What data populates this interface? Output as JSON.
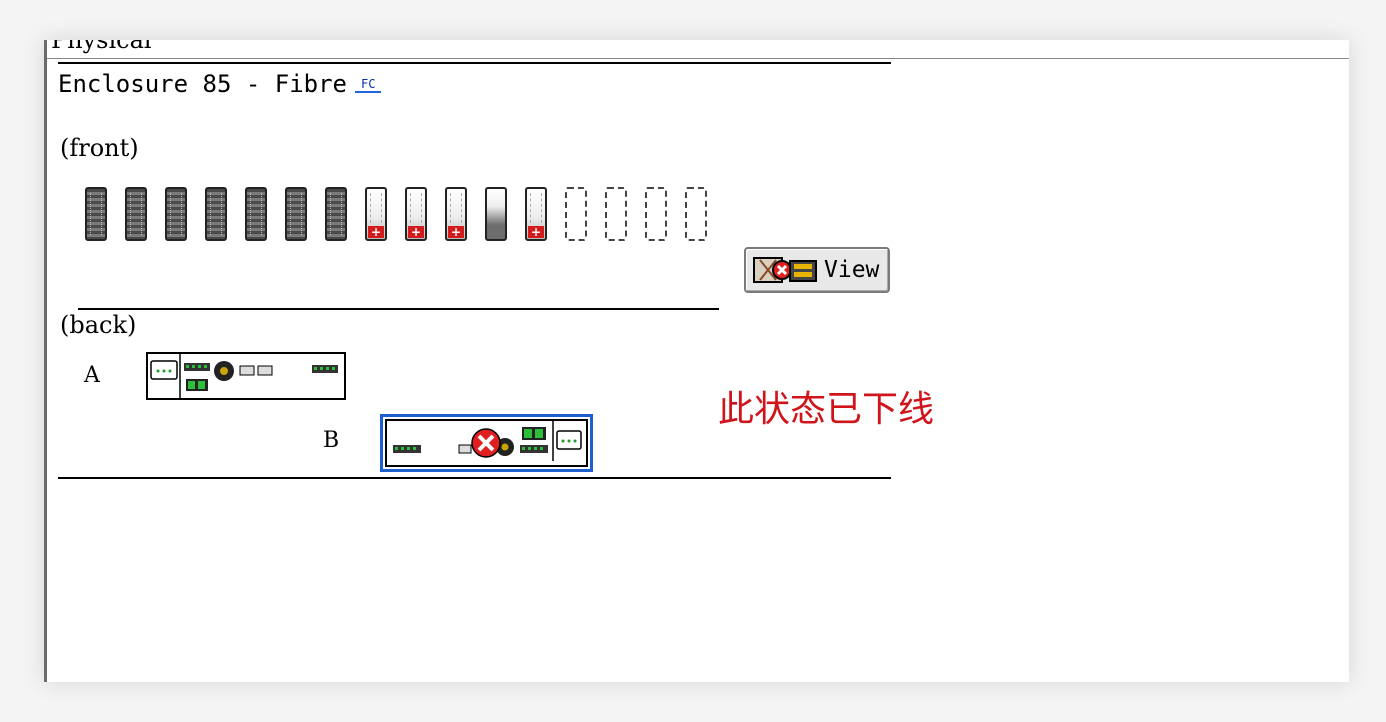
{
  "window": {
    "section_title": "Physical"
  },
  "enclosure": {
    "title": "Enclosure 85 - Fibre",
    "link_label": "FC",
    "front_label": "(front)",
    "back_label": "(back)",
    "drives": [
      {
        "state": "full"
      },
      {
        "state": "full"
      },
      {
        "state": "full"
      },
      {
        "state": "full"
      },
      {
        "state": "full"
      },
      {
        "state": "full"
      },
      {
        "state": "full"
      },
      {
        "state": "spare"
      },
      {
        "state": "spare"
      },
      {
        "state": "spare"
      },
      {
        "state": "half"
      },
      {
        "state": "spare"
      },
      {
        "state": "empty"
      },
      {
        "state": "empty"
      },
      {
        "state": "empty"
      },
      {
        "state": "empty"
      }
    ],
    "view_button_label": "View",
    "module_a_label": "A",
    "module_b_label": "B"
  },
  "annotation": {
    "text": "此状态已下线",
    "color": "#d0141b"
  },
  "colors": {
    "selection_border": "#1e5fd0",
    "fault_red": "#d21b1b",
    "led_green": "#1f9a2a"
  }
}
